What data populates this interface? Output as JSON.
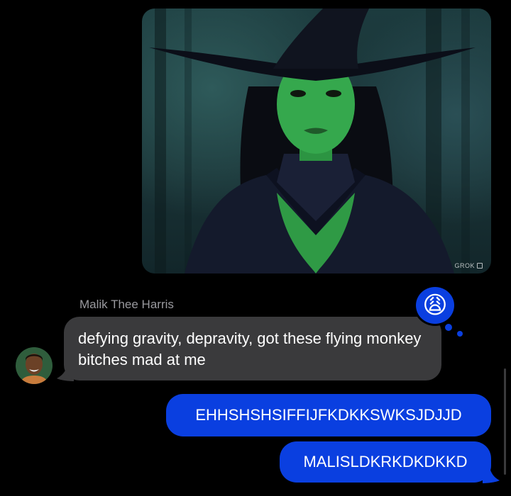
{
  "image_message": {
    "watermark": "GROK",
    "icon": "photo-attachment"
  },
  "incoming": {
    "sender_name": "Malik Thee Harris",
    "text": "defying gravity, depravity, got these flying monkey bitches mad at me",
    "avatar_icon": "contact-avatar"
  },
  "reaction": {
    "emoji": "😩",
    "icon": "weary-face-emoji"
  },
  "outgoing": [
    {
      "text": "EHHSHSHSIFFIJFKDKKSWKSJDJJD"
    },
    {
      "text": "MALISLDKRKDKDKKD"
    }
  ],
  "colors": {
    "background": "#000000",
    "incoming_bubble": "#3a3a3c",
    "outgoing_bubble": "#0a3fe0",
    "sender_name": "#9a9a9f"
  }
}
